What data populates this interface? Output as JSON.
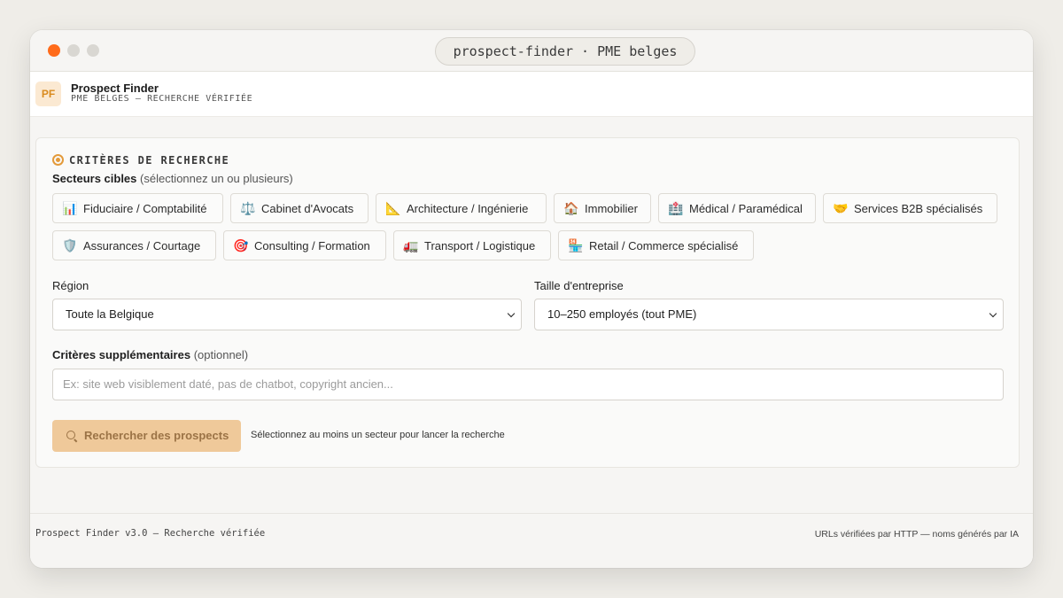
{
  "window": {
    "title": "prospect-finder · PME belges"
  },
  "header": {
    "logo": "PF",
    "title": "Prospect Finder",
    "subtitle": "PME BELGES — RECHERCHE VÉRIFIÉE"
  },
  "form": {
    "heading": "CRITÈRES DE RECHERCHE",
    "sectors_label": "Secteurs cibles",
    "sectors_hint": "(sélectionnez un ou plusieurs)",
    "sectors": [
      {
        "label": "Fiduciaire / Comptabilité",
        "icon": "📊"
      },
      {
        "label": "Cabinet d'Avocats",
        "icon": "⚖️"
      },
      {
        "label": "Architecture / Ingénierie",
        "icon": "📐"
      },
      {
        "label": "Immobilier",
        "icon": "🏠"
      },
      {
        "label": "Médical / Paramédical",
        "icon": "🏥"
      },
      {
        "label": "Services B2B spécialisés",
        "icon": "🤝"
      },
      {
        "label": "Assurances / Courtage",
        "icon": "🛡️"
      },
      {
        "label": "Consulting / Formation",
        "icon": "🎯"
      },
      {
        "label": "Transport / Logistique",
        "icon": "🚛"
      },
      {
        "label": "Retail / Commerce spécialisé",
        "icon": "🏪"
      }
    ],
    "region_label": "Région",
    "region_value": "Toute la Belgique",
    "size_label": "Taille d'entreprise",
    "size_value": "10–250 employés (tout PME)",
    "extra_label": "Critères supplémentaires",
    "extra_optional": "(optionnel)",
    "extra_placeholder": "Ex: site web visiblement daté, pas de chatbot, copyright ancien...",
    "search_button": "Rechercher des prospects",
    "search_hint": "Sélectionnez au moins un secteur pour lancer la recherche"
  },
  "footer": {
    "left": "Prospect Finder v3.0 — Recherche vérifiée",
    "right": "URLs vérifiées par HTTP — noms générés par IA"
  },
  "colors": {
    "accent": "#ff6b1a",
    "button_disabled": "#efc99a"
  }
}
